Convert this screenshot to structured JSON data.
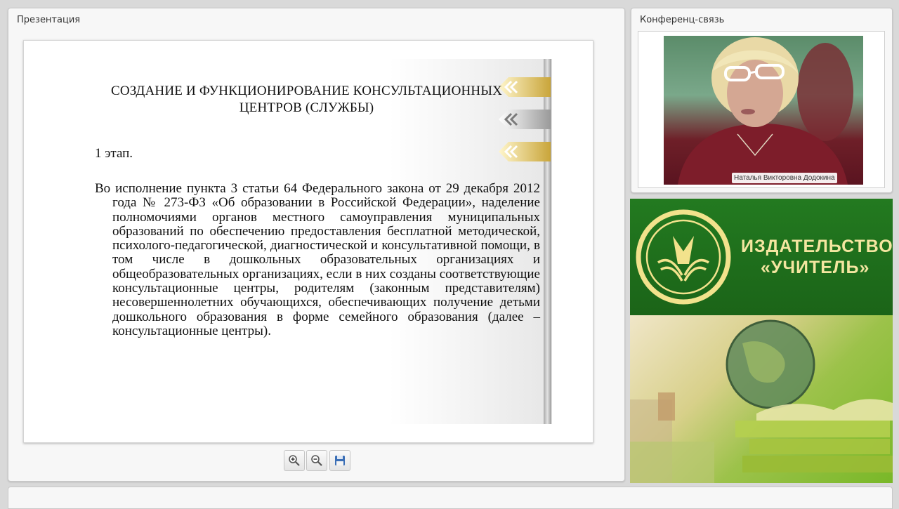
{
  "presentation": {
    "title": "Презентация",
    "slide": {
      "heading_line1": "СОЗДАНИЕ И ФУНКЦИОНИРОВАНИЕ КОНСУЛЬТАЦИОННЫХ",
      "heading_line2": "ЦЕНТРОВ (СЛУЖБЫ)",
      "stage": "1 этап.",
      "body": "Во исполнение пункта 3 статьи 64 Федерального закона от 29 декабря 2012 года № 273-ФЗ «Об образовании в Российской Федерации», наделение полномочиями органов местного самоуправления муниципальных образований по обеспечению предоставления бесплатной методической, психолого-педагогической, диагностической и консультативной помощи, в том числе в дошкольных образовательных организациях и общеобразовательных организациях, если в них созданы соответствующие консультационные центры, родителям (законным представителям) несовершеннолетних обучающихся, обеспечивающих получение детьми дошкольного образования в форме семейного образования (далее – консультационные центры)."
    },
    "toolbar": {
      "zoom_in_icon": "zoom-in-icon",
      "zoom_out_icon": "zoom-out-icon",
      "save_icon": "save-icon"
    }
  },
  "conference": {
    "title": "Конференц-связь",
    "speaker_name": "Наталья Викторовна Додокина"
  },
  "banner": {
    "line1": "ИЗДАТЕЛЬСТВО",
    "line2": "«УЧИТЕЛЬ»"
  },
  "colors": {
    "brand_green": "#1d6b1b",
    "brand_gold": "#f4e6a0",
    "chevron_gold": "#d8b84a"
  }
}
